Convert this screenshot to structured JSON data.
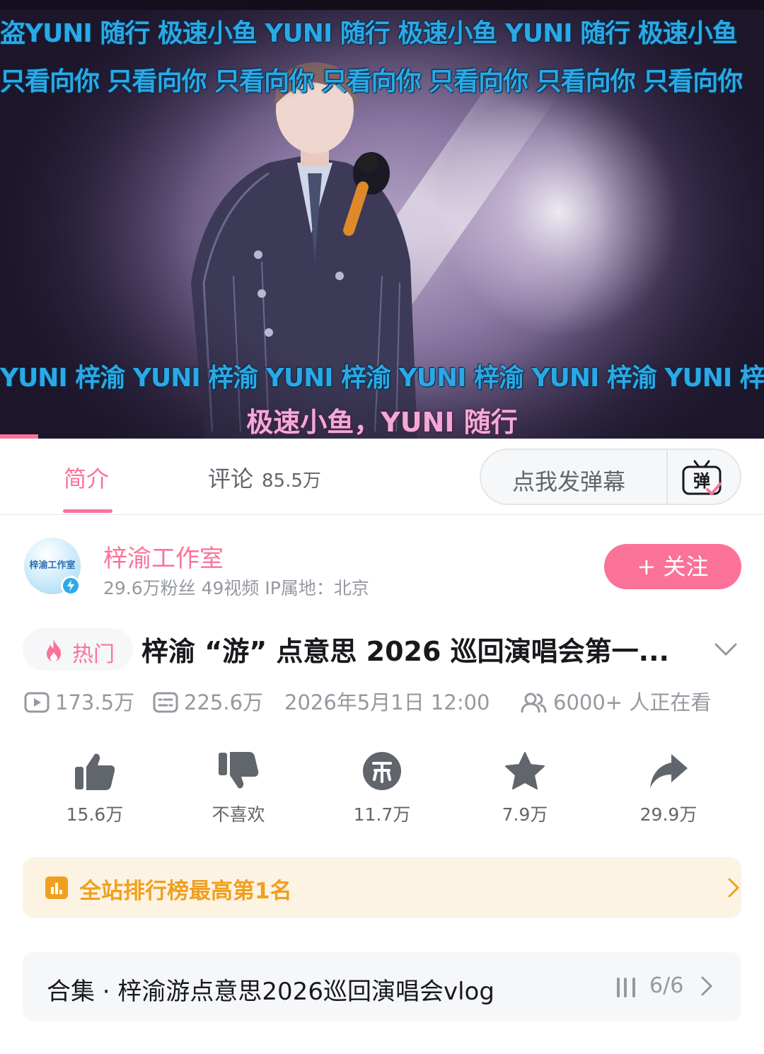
{
  "player": {
    "danmaku": [
      "盗YUNI 随行 极速小鱼 YUNI 随行 极速小鱼 YUNI 随行 极速小鱼",
      "只看向你 只看向你 只看向你 只看向你 只看向你 只看向你 只看向你",
      "YUNI 梓渝 YUNI 梓渝 YUNI 梓渝 YUNI 梓渝 YUNI 梓渝 YUNI 梓渝 YUNI 梓"
    ],
    "subtitle": "极速小鱼，YUNI 随行",
    "progress_fraction": 0.05
  },
  "tabs": {
    "intro_label": "简介",
    "comments_label": "评论",
    "comments_count": "85.5万",
    "danmaku_placeholder": "点我发弹幕",
    "danmaku_icon_label": "弹"
  },
  "uploader": {
    "avatar_text": "梓渝工作室",
    "name": "梓渝工作室",
    "meta": "29.6万粉丝  49视频  IP属地：北京",
    "follow_label": "+ 关注"
  },
  "video": {
    "hot_label": "热门",
    "title": "梓渝 “游” 点意思 2026 巡回演唱会第一...",
    "views": "173.5万",
    "danmaku_count": "225.6万",
    "publish_time": "2026年5月1日 12:00",
    "watching": "6000+ 人正在看"
  },
  "actions": [
    {
      "name": "like",
      "label": "15.6万"
    },
    {
      "name": "dislike",
      "label": "不喜欢"
    },
    {
      "name": "coin",
      "label": "11.7万"
    },
    {
      "name": "favorite",
      "label": "7.9万"
    },
    {
      "name": "share",
      "label": "29.9万"
    }
  ],
  "ranking": {
    "text": "全站排行榜最高第1名"
  },
  "collection": {
    "text": "合集 · 梓渝游点意思2026巡回演唱会vlog",
    "progress": "6/6"
  },
  "colors": {
    "accent": "#fb7299",
    "rank": "#f0a020",
    "muted": "#9499a0"
  }
}
